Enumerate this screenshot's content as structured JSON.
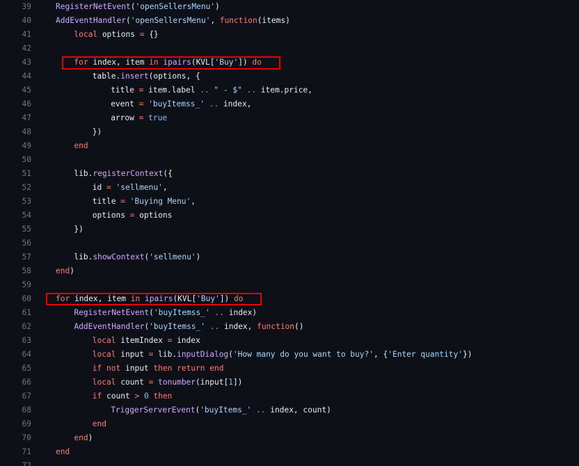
{
  "editor": {
    "highlight_color": "#e60000",
    "lines": [
      {
        "n": "39",
        "indent": 0,
        "tokens": [
          [
            "func",
            "RegisterNetEvent"
          ],
          [
            "plain",
            "("
          ],
          [
            "str",
            "'openSellersMenu'"
          ],
          [
            "plain",
            ")"
          ]
        ]
      },
      {
        "n": "40",
        "indent": 0,
        "tokens": [
          [
            "func",
            "AddEventHandler"
          ],
          [
            "plain",
            "("
          ],
          [
            "str",
            "'openSellersMenu'"
          ],
          [
            "plain",
            ", "
          ],
          [
            "kw",
            "function"
          ],
          [
            "plain",
            "(items)"
          ]
        ]
      },
      {
        "n": "41",
        "indent": 1,
        "tokens": [
          [
            "kw",
            "local"
          ],
          [
            "plain",
            " options "
          ],
          [
            "op",
            "="
          ],
          [
            "plain",
            " {}"
          ]
        ]
      },
      {
        "n": "42",
        "indent": 0,
        "tokens": []
      },
      {
        "n": "43",
        "indent": 1,
        "tokens": [
          [
            "kw",
            "for"
          ],
          [
            "plain",
            " index, item "
          ],
          [
            "kw",
            "in"
          ],
          [
            "plain",
            " "
          ],
          [
            "func",
            "ipairs"
          ],
          [
            "plain",
            "(KVL["
          ],
          [
            "str",
            "'Buy'"
          ],
          [
            "plain",
            "]) "
          ],
          [
            "kw",
            "do"
          ]
        ]
      },
      {
        "n": "44",
        "indent": 2,
        "tokens": [
          [
            "plain",
            "table."
          ],
          [
            "func",
            "insert"
          ],
          [
            "plain",
            "(options, {"
          ]
        ]
      },
      {
        "n": "45",
        "indent": 3,
        "tokens": [
          [
            "plain",
            "title "
          ],
          [
            "op",
            "="
          ],
          [
            "plain",
            " item.label "
          ],
          [
            "op",
            ".."
          ],
          [
            "plain",
            " "
          ],
          [
            "str",
            "\" - $\""
          ],
          [
            "plain",
            " "
          ],
          [
            "op",
            ".."
          ],
          [
            "plain",
            " item.price,"
          ]
        ]
      },
      {
        "n": "46",
        "indent": 3,
        "tokens": [
          [
            "plain",
            "event "
          ],
          [
            "op",
            "="
          ],
          [
            "plain",
            " "
          ],
          [
            "str",
            "'buyItemss_'"
          ],
          [
            "plain",
            " "
          ],
          [
            "op",
            ".."
          ],
          [
            "plain",
            " index,"
          ]
        ]
      },
      {
        "n": "47",
        "indent": 3,
        "tokens": [
          [
            "plain",
            "arrow "
          ],
          [
            "op",
            "="
          ],
          [
            "plain",
            " "
          ],
          [
            "num",
            "true"
          ]
        ]
      },
      {
        "n": "48",
        "indent": 2,
        "tokens": [
          [
            "plain",
            "})"
          ]
        ]
      },
      {
        "n": "49",
        "indent": 1,
        "tokens": [
          [
            "kw",
            "end"
          ]
        ]
      },
      {
        "n": "50",
        "indent": 0,
        "tokens": []
      },
      {
        "n": "51",
        "indent": 1,
        "tokens": [
          [
            "plain",
            "lib."
          ],
          [
            "func",
            "registerContext"
          ],
          [
            "plain",
            "({"
          ]
        ]
      },
      {
        "n": "52",
        "indent": 2,
        "tokens": [
          [
            "plain",
            "id "
          ],
          [
            "op",
            "="
          ],
          [
            "plain",
            " "
          ],
          [
            "str",
            "'sellmenu'"
          ],
          [
            "plain",
            ","
          ]
        ]
      },
      {
        "n": "53",
        "indent": 2,
        "tokens": [
          [
            "plain",
            "title "
          ],
          [
            "op",
            "="
          ],
          [
            "plain",
            " "
          ],
          [
            "str",
            "'Buying Menu'"
          ],
          [
            "plain",
            ","
          ]
        ]
      },
      {
        "n": "54",
        "indent": 2,
        "tokens": [
          [
            "plain",
            "options "
          ],
          [
            "op",
            "="
          ],
          [
            "plain",
            " options"
          ]
        ]
      },
      {
        "n": "55",
        "indent": 1,
        "tokens": [
          [
            "plain",
            "})"
          ]
        ]
      },
      {
        "n": "56",
        "indent": 0,
        "tokens": []
      },
      {
        "n": "57",
        "indent": 1,
        "tokens": [
          [
            "plain",
            "lib."
          ],
          [
            "func",
            "showContext"
          ],
          [
            "plain",
            "("
          ],
          [
            "str",
            "'sellmenu'"
          ],
          [
            "plain",
            ")"
          ]
        ]
      },
      {
        "n": "58",
        "indent": 0,
        "tokens": [
          [
            "kw",
            "end"
          ],
          [
            "plain",
            ")"
          ]
        ]
      },
      {
        "n": "59",
        "indent": 0,
        "tokens": []
      },
      {
        "n": "60",
        "indent": 0,
        "tokens": [
          [
            "kw",
            "for"
          ],
          [
            "plain",
            " index, item "
          ],
          [
            "kw",
            "in"
          ],
          [
            "plain",
            " "
          ],
          [
            "func",
            "ipairs"
          ],
          [
            "plain",
            "(KVL["
          ],
          [
            "str",
            "'Buy'"
          ],
          [
            "plain",
            "]) "
          ],
          [
            "kw",
            "do"
          ]
        ]
      },
      {
        "n": "61",
        "indent": 1,
        "tokens": [
          [
            "func",
            "RegisterNetEvent"
          ],
          [
            "plain",
            "("
          ],
          [
            "str",
            "'buyItemss_'"
          ],
          [
            "plain",
            " "
          ],
          [
            "op",
            ".."
          ],
          [
            "plain",
            " index)"
          ]
        ]
      },
      {
        "n": "62",
        "indent": 1,
        "tokens": [
          [
            "func",
            "AddEventHandler"
          ],
          [
            "plain",
            "("
          ],
          [
            "str",
            "'buyItemss_'"
          ],
          [
            "plain",
            " "
          ],
          [
            "op",
            ".."
          ],
          [
            "plain",
            " index, "
          ],
          [
            "kw",
            "function"
          ],
          [
            "plain",
            "()"
          ]
        ]
      },
      {
        "n": "63",
        "indent": 2,
        "tokens": [
          [
            "kw",
            "local"
          ],
          [
            "plain",
            " itemIndex "
          ],
          [
            "op",
            "="
          ],
          [
            "plain",
            " index"
          ]
        ]
      },
      {
        "n": "64",
        "indent": 2,
        "tokens": [
          [
            "kw",
            "local"
          ],
          [
            "plain",
            " input "
          ],
          [
            "op",
            "="
          ],
          [
            "plain",
            " lib."
          ],
          [
            "func",
            "inputDialog"
          ],
          [
            "plain",
            "("
          ],
          [
            "str",
            "'How many do you want to buy?'"
          ],
          [
            "plain",
            ", {"
          ],
          [
            "str",
            "'Enter quantity'"
          ],
          [
            "plain",
            "})"
          ]
        ]
      },
      {
        "n": "65",
        "indent": 2,
        "tokens": [
          [
            "kw",
            "if"
          ],
          [
            "plain",
            " "
          ],
          [
            "kw",
            "not"
          ],
          [
            "plain",
            " input "
          ],
          [
            "kw",
            "then"
          ],
          [
            "plain",
            " "
          ],
          [
            "kw",
            "return"
          ],
          [
            "plain",
            " "
          ],
          [
            "kw",
            "end"
          ]
        ]
      },
      {
        "n": "66",
        "indent": 2,
        "tokens": [
          [
            "kw",
            "local"
          ],
          [
            "plain",
            " count "
          ],
          [
            "op",
            "="
          ],
          [
            "plain",
            " "
          ],
          [
            "func",
            "tonumber"
          ],
          [
            "plain",
            "(input["
          ],
          [
            "num",
            "1"
          ],
          [
            "plain",
            "])"
          ]
        ]
      },
      {
        "n": "67",
        "indent": 2,
        "tokens": [
          [
            "kw",
            "if"
          ],
          [
            "plain",
            " count "
          ],
          [
            "op",
            ">"
          ],
          [
            "plain",
            " "
          ],
          [
            "num",
            "0"
          ],
          [
            "plain",
            " "
          ],
          [
            "kw",
            "then"
          ]
        ]
      },
      {
        "n": "68",
        "indent": 3,
        "tokens": [
          [
            "func",
            "TriggerServerEvent"
          ],
          [
            "plain",
            "("
          ],
          [
            "str",
            "'buyItems_'"
          ],
          [
            "plain",
            " "
          ],
          [
            "op",
            ".."
          ],
          [
            "plain",
            " index, count)"
          ]
        ]
      },
      {
        "n": "69",
        "indent": 2,
        "tokens": [
          [
            "kw",
            "end"
          ]
        ]
      },
      {
        "n": "70",
        "indent": 1,
        "tokens": [
          [
            "kw",
            "end"
          ],
          [
            "plain",
            ")"
          ]
        ]
      },
      {
        "n": "71",
        "indent": 0,
        "tokens": [
          [
            "kw",
            "end"
          ]
        ]
      },
      {
        "n": "72",
        "indent": 0,
        "tokens": []
      }
    ]
  }
}
